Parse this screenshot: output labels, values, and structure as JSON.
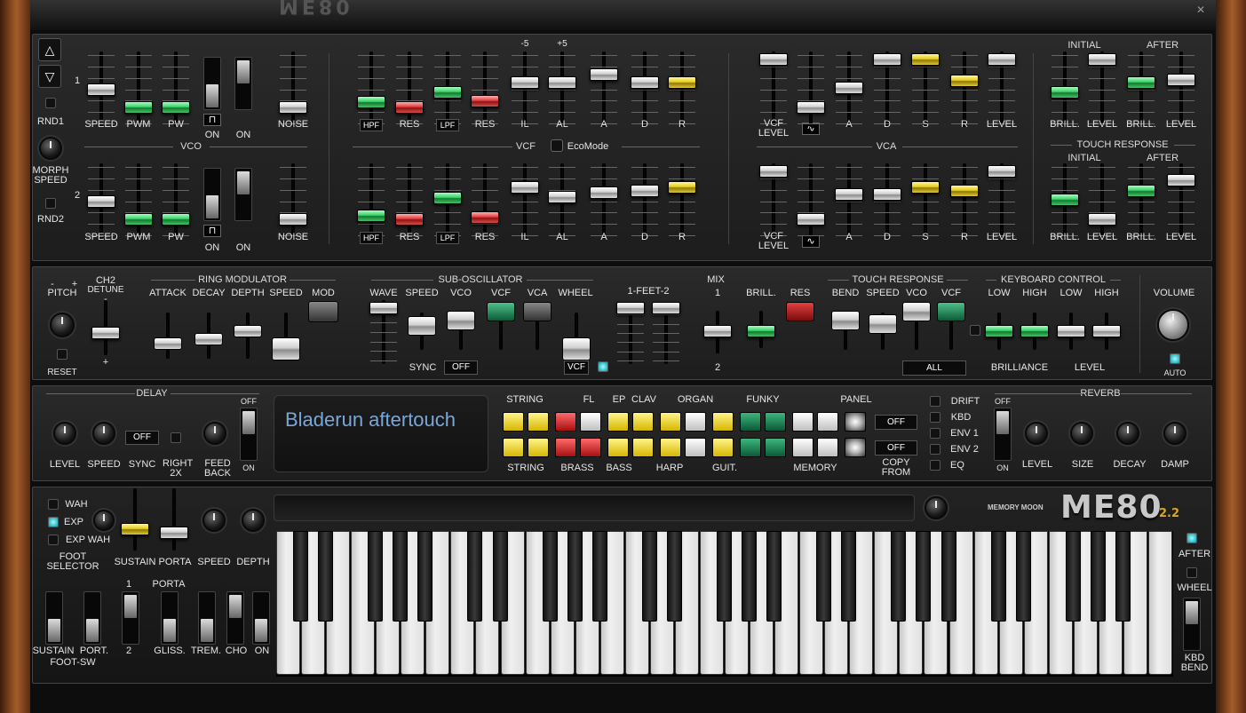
{
  "app": {
    "brand": "ME80",
    "version": "2.2",
    "maker": "MEMORY MOON",
    "close": "✕"
  },
  "vco": {
    "title": "VCO",
    "row1": "1",
    "row2": "2",
    "speed": "SPEED",
    "pwm": "PWM",
    "pw": "PW",
    "on": "ON",
    "noise": "NOISE",
    "wave": "⊓"
  },
  "left": {
    "rnd1": "RND1",
    "rnd2": "RND2",
    "morph": "MORPH SPEED"
  },
  "vcf": {
    "title": "VCF",
    "hpf": "HPF",
    "lpf": "LPF",
    "res": "RES",
    "il": "IL",
    "al": "AL",
    "a": "A",
    "d": "D",
    "r": "R",
    "minus5": "-5",
    "plus5": "+5",
    "eco": "EcoMode"
  },
  "vca": {
    "title": "VCA",
    "vcf_level": "VCF LEVEL",
    "a": "A",
    "d": "D",
    "s": "S",
    "r": "R",
    "level": "LEVEL",
    "sine": "∿"
  },
  "brill": {
    "initial": "INITIAL",
    "after": "AFTER",
    "brill": "BRILL.",
    "level": "LEVEL",
    "touch": "TOUCH RESPONSE"
  },
  "mod": {
    "pitch": "PITCH",
    "minus": "-",
    "plus": "+",
    "reset": "RESET",
    "ch2": "CH2",
    "detune": "DETUNE",
    "dash": "-",
    "plus2": "+",
    "ring": "RING MODULATOR",
    "attack": "ATTACK",
    "decay": "DECAY",
    "depth": "DEPTH",
    "speed": "SPEED",
    "mod": "MOD",
    "sub": "SUB-OSCILLATOR",
    "wave": "WAVE",
    "sub_speed": "SPEED",
    "vco": "VCO",
    "vcf": "VCF",
    "vca": "VCA",
    "wheel": "WHEEL",
    "sync": "SYNC",
    "off": "OFF",
    "vcf_btn": "VCF",
    "feet": "1-FEET-2",
    "mix": "MIX",
    "mix1": "1",
    "mix2": "2",
    "brill": "BRILL.",
    "res": "RES",
    "touch": "TOUCH RESPONSE",
    "bend": "BEND",
    "t_speed": "SPEED",
    "t_vco": "VCO",
    "t_vcf": "VCF",
    "all": "ALL",
    "kbd": "KEYBOARD CONTROL",
    "low": "LOW",
    "high": "HIGH",
    "low2": "LOW",
    "high2": "HIGH",
    "brilliance": "BRILLIANCE",
    "level": "LEVEL",
    "volume": "VOLUME",
    "auto": "AUTO"
  },
  "delay": {
    "title": "DELAY",
    "level": "LEVEL",
    "speed": "SPEED",
    "sync": "SYNC",
    "right": "RIGHT 2X",
    "feedback": "FEED BACK",
    "off": "OFF",
    "on": "ON",
    "sync_off": "OFF"
  },
  "display": {
    "text": "Bladerun aftertouch"
  },
  "presets": {
    "top": [
      "STRING",
      "FL",
      "EP",
      "CLAV",
      "ORGAN",
      "FUNKY",
      "PANEL"
    ],
    "bottom": [
      "STRING",
      "BRASS",
      "BASS",
      "HARP",
      "GUIT.",
      "MEMORY"
    ],
    "copy": "COPY FROM",
    "off1": "OFF",
    "off2": "OFF"
  },
  "fx": {
    "drift": "DRIFT",
    "kbd": "KBD",
    "env1": "ENV 1",
    "env2": "ENV 2",
    "eq": "EQ"
  },
  "reverb": {
    "title": "REVERB",
    "off": "OFF",
    "on": "ON",
    "level": "LEVEL",
    "size": "SIZE",
    "decay": "DECAY",
    "damp": "DAMP"
  },
  "perf": {
    "wah": "WAH",
    "exp": "EXP",
    "expwah": "EXP WAH",
    "foot": "FOOT SELECTOR",
    "sustain": "SUSTAIN",
    "porta": "PORTA",
    "speed": "SPEED",
    "depth": "DEPTH",
    "porta_t": "PORTA",
    "one": "1",
    "two": "2",
    "sustain2": "SUSTAIN",
    "port": "PORT.",
    "footsw": "FOOT-SW",
    "gliss": "GLISS.",
    "trem": "TREM.",
    "cho": "CHO",
    "on": "ON"
  },
  "right": {
    "after": "AFTER",
    "wheel": "WHEEL",
    "kbd": "KBD BEND"
  },
  "colors": {
    "green": "#3ed06a",
    "red": "#e03b3b",
    "yellow": "#e8cd1a",
    "white": "#dddddd"
  }
}
